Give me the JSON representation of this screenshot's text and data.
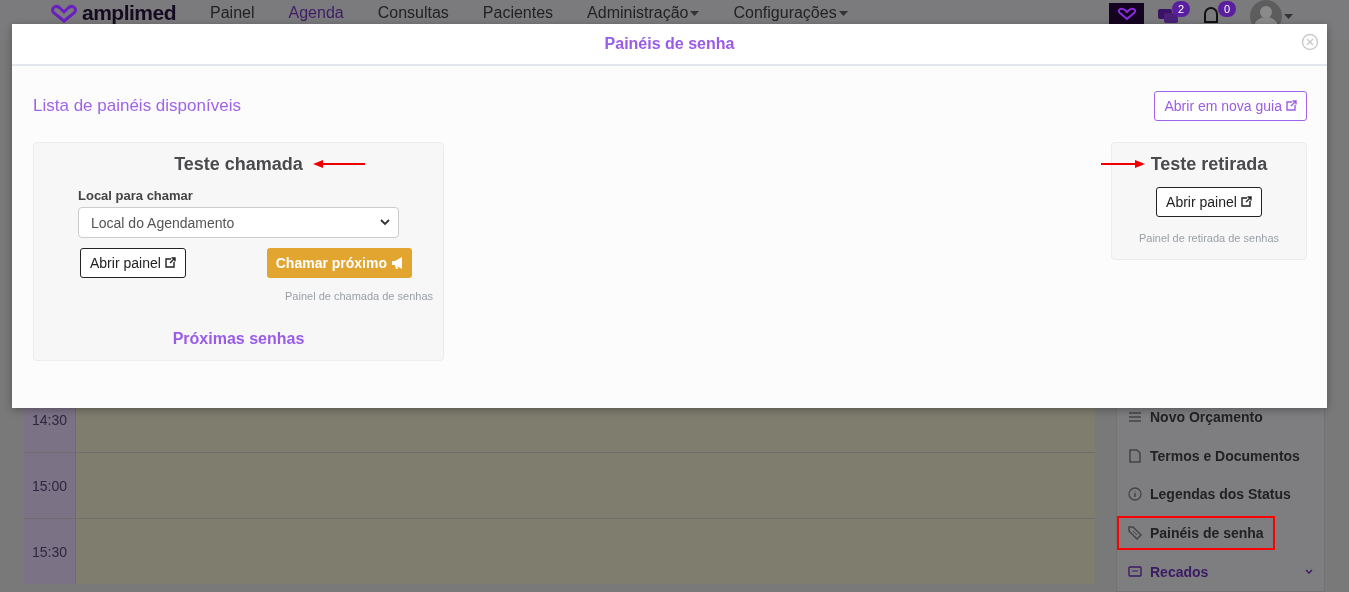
{
  "nav": {
    "logo": "amplimed",
    "items": [
      {
        "label": "Painel",
        "selected": false,
        "dropdown": false
      },
      {
        "label": "Agenda",
        "selected": true,
        "dropdown": false
      },
      {
        "label": "Consultas",
        "selected": false,
        "dropdown": false
      },
      {
        "label": "Pacientes",
        "selected": false,
        "dropdown": false
      },
      {
        "label": "Administração",
        "selected": false,
        "dropdown": true
      },
      {
        "label": "Configurações",
        "selected": false,
        "dropdown": true
      }
    ],
    "icons": [
      {
        "kind": "chat",
        "badge": "2"
      },
      {
        "kind": "bell",
        "badge": "0"
      }
    ]
  },
  "calendar": {
    "rows": [
      {
        "time": "14:30"
      },
      {
        "time": "15:00"
      },
      {
        "time": "15:30"
      }
    ]
  },
  "sidebar": {
    "items": [
      {
        "kind": "list",
        "label": "Novo Orçamento",
        "active": false,
        "highlighted": false,
        "expandable": false
      },
      {
        "kind": "document",
        "label": "Termos e Documentos",
        "active": false,
        "highlighted": false,
        "expandable": false
      },
      {
        "kind": "info",
        "label": "Legendas dos Status",
        "active": false,
        "highlighted": false,
        "expandable": false
      },
      {
        "kind": "ticket",
        "label": "Painéis de senha",
        "active": false,
        "highlighted": true,
        "expandable": false
      },
      {
        "kind": "message",
        "label": "Recados",
        "active": true,
        "highlighted": false,
        "expandable": true
      }
    ]
  },
  "modal": {
    "title": "Painéis de senha",
    "heading": "Lista de painéis disponíveis",
    "open_tab_button": "Abrir em nova guia",
    "panels": [
      {
        "kind": "call",
        "title": "Teste chamada",
        "annotated": true,
        "field_label": "Local para chamar",
        "select_value": "Local do Agendamento",
        "open_button": "Abrir painel",
        "call_button": "Chamar próximo",
        "caption": "Painel de chamada de senhas",
        "next_heading": "Próximas senhas"
      },
      {
        "kind": "pickup",
        "title": "Teste retirada",
        "annotated": true,
        "open_button": "Abrir painel",
        "caption": "Painel de retirada de senhas"
      }
    ]
  }
}
